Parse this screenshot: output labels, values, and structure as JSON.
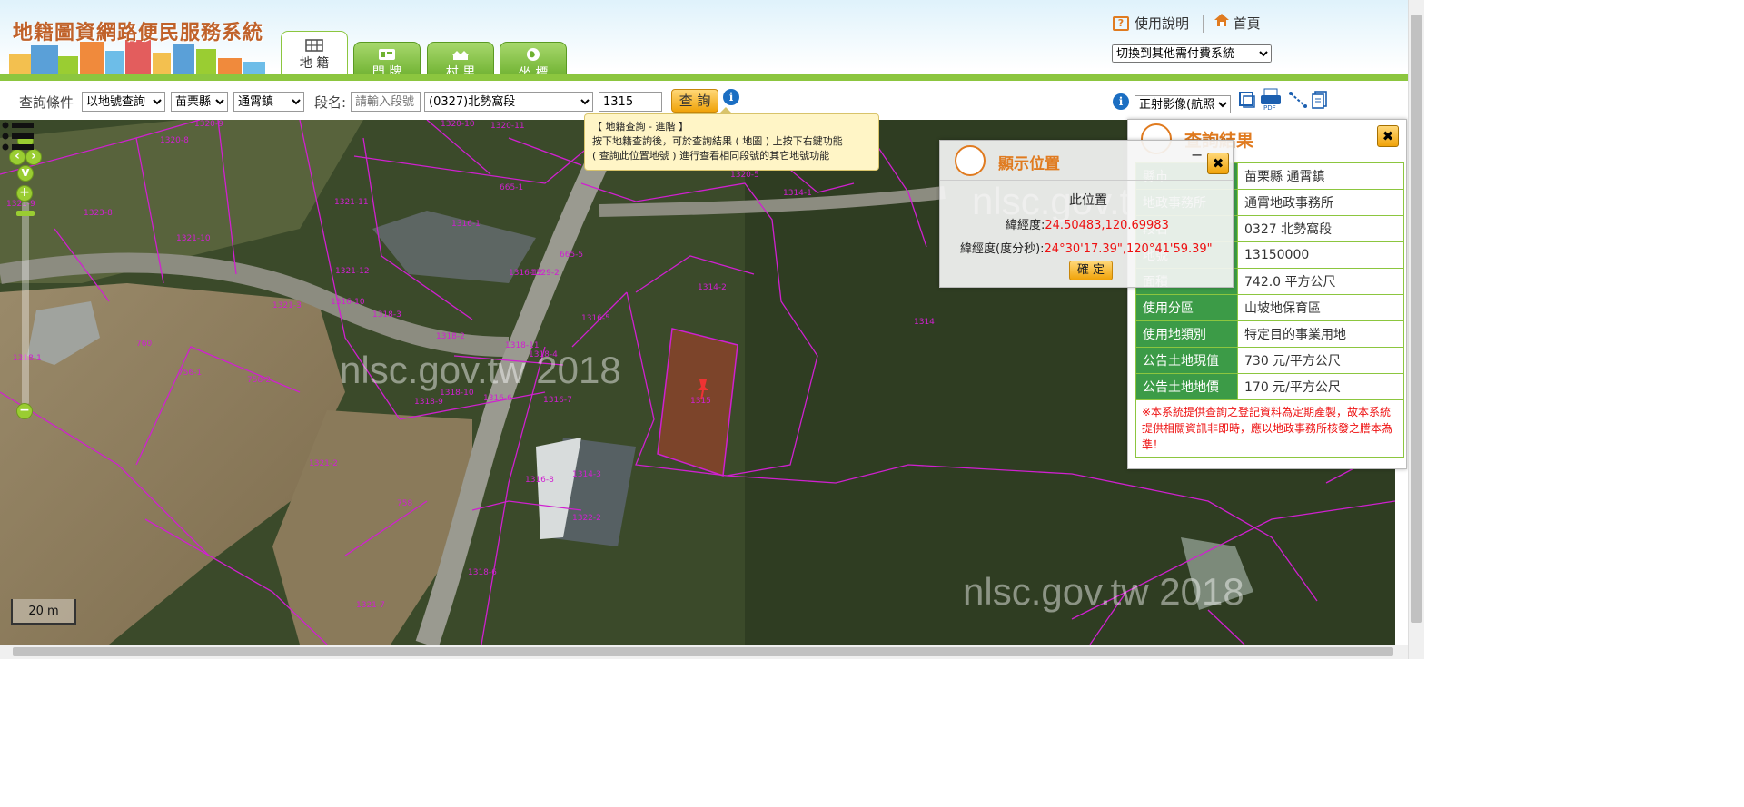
{
  "header": {
    "title": "地籍圖資網路便民服務系統",
    "tabs": [
      {
        "label": "地 籍",
        "icon": "map-icon",
        "active": true
      },
      {
        "label": "門 牌",
        "icon": "doorplate-icon",
        "active": false
      },
      {
        "label": "村 里",
        "icon": "village-icon",
        "active": false
      },
      {
        "label": "坐 標",
        "icon": "globe-icon",
        "active": false
      }
    ],
    "help_label": "使用說明",
    "home_label": "首頁",
    "switch_select": "切換到其他需付費系統"
  },
  "search": {
    "condition_label": "查詢條件",
    "mode": "以地號查詢",
    "county": "苗栗縣",
    "town": "通霄鎮",
    "section_label": "段名:",
    "section_placeholder": "請輸入段號",
    "section_select": "(0327)北勢窩段",
    "parcel_value": "1315",
    "query_button": "查 詢",
    "info_icon": "i",
    "imagery_select": "正射影像(航照"
  },
  "tooltip": {
    "title": "【 地籍查詢 - 進階 】",
    "line1": "按下地籍查詢後，可於查詢結果 ( 地圖 ) 上按下右鍵功能",
    "line2": "( 查詢此位置地號 ) 進行查看相同段號的其它地號功能"
  },
  "map": {
    "watermark": "nlsc.gov.tw 2018",
    "scale": "20 m",
    "parcel_labels": [
      "1320-8",
      "1320-9",
      "1320-11",
      "1320-10",
      "1323-8",
      "1320-5",
      "1314-1",
      "1321-9",
      "1321-10",
      "1321-11",
      "665-1",
      "1315",
      "1314-2",
      "1314",
      "1318-3",
      "1318-2",
      "1321-12",
      "1316-10",
      "1316-12",
      "1316-6",
      "1316-7",
      "760",
      "758-2",
      "1316-1",
      "1316-5",
      "1321-2",
      "758",
      "756-1",
      "1318-4",
      "1321-3",
      "665-5",
      "1318-1",
      "1318-9",
      "1318-10",
      "1318-11",
      "1316-8",
      "1314-3",
      "1318-6",
      "1321-7",
      "1329-2",
      "1322-2"
    ]
  },
  "result": {
    "title": "查詢結果",
    "rows": [
      {
        "key": "縣市",
        "value": "苗栗縣 通霄鎮"
      },
      {
        "key": "地政事務所",
        "value": "通霄地政事務所"
      },
      {
        "key": "段名",
        "value": "0327 北勢窩段"
      },
      {
        "key": "地號",
        "value": "13150000"
      },
      {
        "key": "面積",
        "value": "742.0 平方公尺"
      },
      {
        "key": "使用分區",
        "value": "山坡地保育區"
      },
      {
        "key": "使用地類別",
        "value": "特定目的事業用地"
      },
      {
        "key": "公告土地現值",
        "value": "730 元/平方公尺"
      },
      {
        "key": "公告土地地價",
        "value": "170 元/平方公尺"
      }
    ],
    "notice": "※本系統提供查詢之登記資料為定期產製，故本系統提供相關資訊非即時，應以地政事務所核發之謄本為準！"
  },
  "position_dialog": {
    "title": "顯示位置",
    "heading": "此位置",
    "latlon_label": "緯經度:",
    "latlon_value": "24.50483,120.69983",
    "dms_label": "緯經度(度分秒):",
    "dms_value": "24°30'17.39\",120°41'59.39\"",
    "ok_button": "確 定",
    "minimize": "−"
  },
  "colors": {
    "green": "#8cc63f",
    "dark_green": "#3c9b47",
    "orange": "#e07b20",
    "parcel_line": "#d020d0",
    "selected_parcel": "#b3402a"
  }
}
